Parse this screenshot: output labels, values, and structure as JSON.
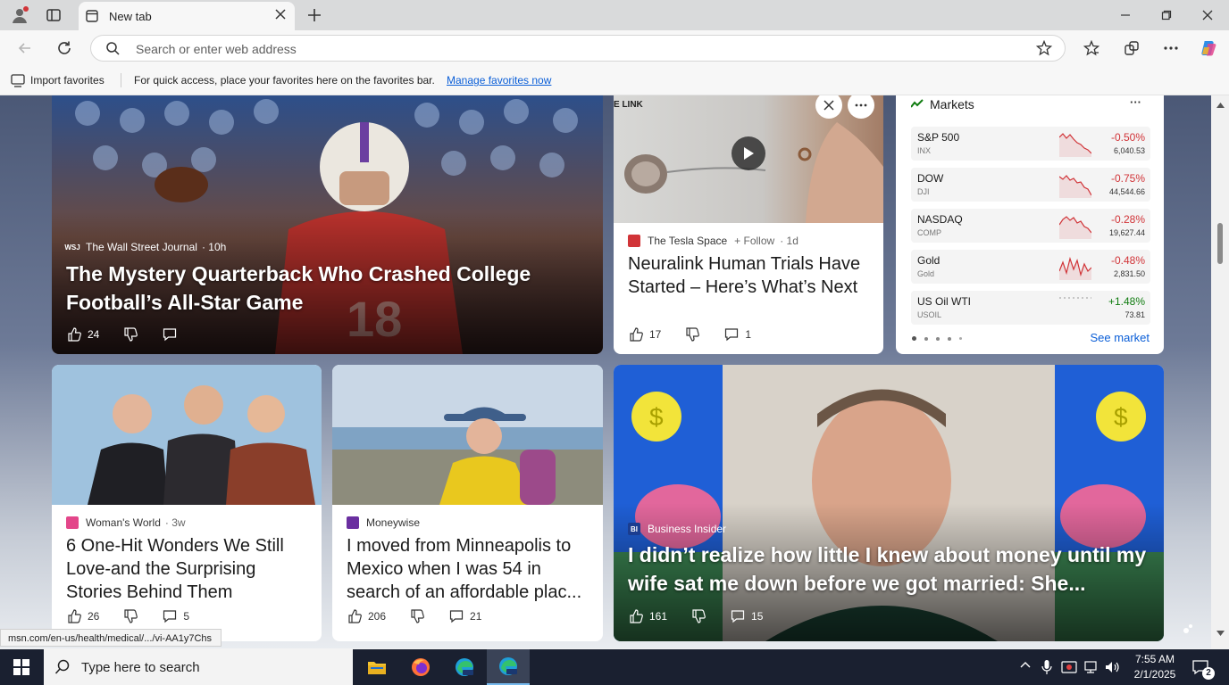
{
  "browser": {
    "tab_title": "New tab",
    "address_placeholder": "Search or enter web address",
    "favorites_bar": {
      "import_label": "Import favorites",
      "hint_text": "For quick access, place your favorites here on the favorites bar.",
      "manage_link": "Manage favorites now"
    },
    "status_url": "msn.com/en-us/health/medical/.../vi-AA1y7Chs"
  },
  "hero": {
    "source": "The Wall Street Journal",
    "source_logo": "WSJ",
    "age": "· 10h",
    "headline": "The Mystery Quarterback Who Crashed College Football’s All-Star Game",
    "likes": "24"
  },
  "video_card": {
    "thumb_label": "E LINK",
    "source": "The Tesla Space",
    "follow_label": "+ Follow",
    "age": "· 1d",
    "headline": "Neuralink Human Trials Have Started – Here’s What’s Next",
    "likes": "17",
    "comments": "1"
  },
  "markets": {
    "title": "Markets",
    "more": "···",
    "rows": [
      {
        "name": "S&P 500",
        "symbol": "INX",
        "change": "-0.50%",
        "value": "6,040.53",
        "color": "#d13438"
      },
      {
        "name": "DOW",
        "symbol": "DJI",
        "change": "-0.75%",
        "value": "44,544.66",
        "color": "#d13438"
      },
      {
        "name": "NASDAQ",
        "symbol": "COMP",
        "change": "-0.28%",
        "value": "19,627.44",
        "color": "#d13438"
      },
      {
        "name": "Gold",
        "symbol": "Gold",
        "change": "-0.48%",
        "value": "2,831.50",
        "color": "#d13438"
      },
      {
        "name": "US Oil WTI",
        "symbol": "USOIL",
        "change": "+1.48%",
        "value": "73.81",
        "color": "#107c10"
      }
    ],
    "see_market": "See market"
  },
  "cards": [
    {
      "source": "Woman's World",
      "age": "· 3w",
      "headline": "6 One-Hit Wonders We Still Love-and the Surprising Stories Behind Them",
      "likes": "26",
      "comments": "5"
    },
    {
      "source": "Moneywise",
      "age": "",
      "headline": "I moved from Minneapolis to Mexico when I was 54 in search of an affordable plac...",
      "likes": "206",
      "comments": "21"
    }
  ],
  "big_card": {
    "source": "Business Insider",
    "source_logo": "BI",
    "headline": "I didn’t realize how little I knew about money until my wife sat me down before we got married: She...",
    "likes": "161",
    "comments": "15"
  },
  "taskbar": {
    "search_placeholder": "Type here to search",
    "time": "7:55 AM",
    "date": "2/1/2025",
    "notification_count": "2"
  }
}
